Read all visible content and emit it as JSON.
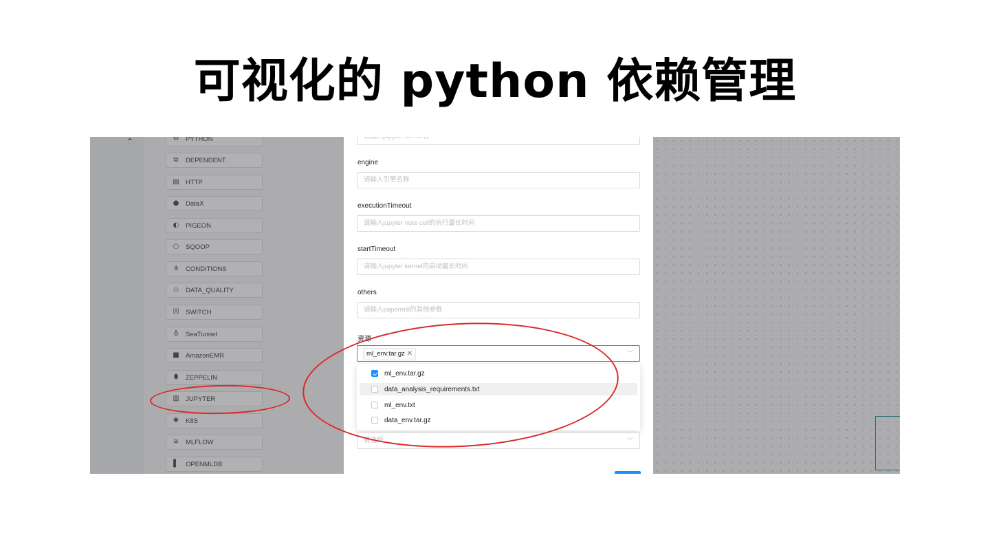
{
  "slide": {
    "title": "可视化的 python 依赖管理"
  },
  "task_panel": {
    "collapse_icon": "chevron-up-icon",
    "items": [
      {
        "label": "PYTHON",
        "icon": "python-icon"
      },
      {
        "label": "DEPENDENT",
        "icon": "dependent-icon"
      },
      {
        "label": "HTTP",
        "icon": "http-icon"
      },
      {
        "label": "DataX",
        "icon": "datax-icon"
      },
      {
        "label": "PIGEON",
        "icon": "pigeon-icon"
      },
      {
        "label": "SQOOP",
        "icon": "sqoop-icon"
      },
      {
        "label": "CONDITIONS",
        "icon": "conditions-icon"
      },
      {
        "label": "DATA_QUALITY",
        "icon": "data-quality-icon"
      },
      {
        "label": "SWITCH",
        "icon": "switch-icon"
      },
      {
        "label": "SeaTunnel",
        "icon": "seatunnel-icon"
      },
      {
        "label": "AmazonEMR",
        "icon": "amazonemr-icon"
      },
      {
        "label": "ZEPPELIN",
        "icon": "zeppelin-icon"
      },
      {
        "label": "JUPYTER",
        "icon": "jupyter-icon"
      },
      {
        "label": "K8S",
        "icon": "k8s-icon"
      },
      {
        "label": "MLFLOW",
        "icon": "mlflow-icon"
      },
      {
        "label": "OPENMLDB",
        "icon": "openmldb-icon"
      }
    ]
  },
  "form": {
    "kernel_placeholder": "请输入jupyter kernel名",
    "engine": {
      "label": "engine",
      "placeholder": "请输入引擎名称"
    },
    "execution_timeout": {
      "label": "executionTimeout",
      "placeholder": "请输入jupyter note cell的执行最长时间"
    },
    "start_timeout": {
      "label": "startTimeout",
      "placeholder": "请输入jupyter kernel的启动最长时间"
    },
    "others": {
      "label": "others",
      "placeholder": "请输入papermill的其他参数"
    },
    "resources": {
      "label": "资源",
      "selected_tag": "ml_env.tar.gz",
      "options": [
        {
          "label": "ml_env.tar.gz",
          "checked": true
        },
        {
          "label": "data_analysis_requirements.txt",
          "checked": false
        },
        {
          "label": "ml_env.txt",
          "checked": false
        },
        {
          "label": "data_env.tar.gz",
          "checked": false
        }
      ]
    },
    "next_select_placeholder": "请选择"
  },
  "colors": {
    "accent": "#1890ff",
    "annotation": "#d9282a"
  }
}
